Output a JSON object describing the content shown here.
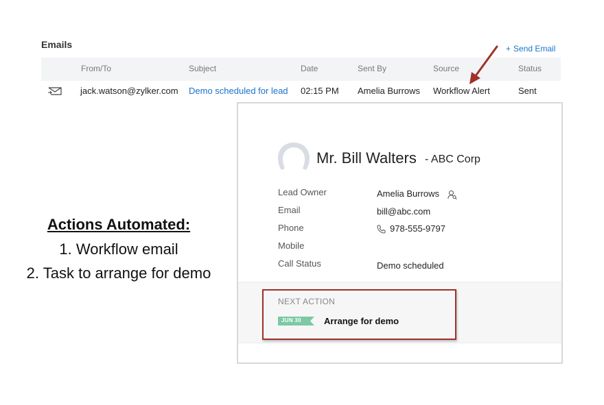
{
  "emails": {
    "title": "Emails",
    "send_email_label": "Send Email",
    "columns": [
      "From/To",
      "Subject",
      "Date",
      "Sent By",
      "Source",
      "Status"
    ],
    "row": {
      "from_to": "jack.watson@zylker.com",
      "subject": "Demo scheduled for lead",
      "date": "02:15 PM",
      "sent_by": "Amelia Burrows",
      "source": "Workflow Alert",
      "status": "Sent"
    }
  },
  "lead": {
    "name": "Mr. Bill Walters",
    "company": "- ABC Corp",
    "fields": [
      {
        "label": "Lead Owner",
        "value": "Amelia Burrows"
      },
      {
        "label": "Email",
        "value": "bill@abc.com"
      },
      {
        "label": "Phone",
        "value": "978-555-9797"
      },
      {
        "label": "Mobile",
        "value": ""
      },
      {
        "label": "Call Status",
        "value": "Demo scheduled"
      }
    ],
    "next_action": {
      "label": "NEXT ACTION",
      "date_tag": "JUN 30",
      "task": "Arrange for demo"
    }
  },
  "annotation": {
    "title": "Actions Automated:",
    "items": [
      "1. Workflow email",
      "2. Task to arrange for demo"
    ]
  },
  "colors": {
    "link": "#1a73c9",
    "highlight_border": "#a0302a",
    "date_tag": "#7cc9a3"
  },
  "icons": [
    "mail-icon",
    "avatar-icon",
    "user-search-icon",
    "phone-icon",
    "plus-icon"
  ]
}
